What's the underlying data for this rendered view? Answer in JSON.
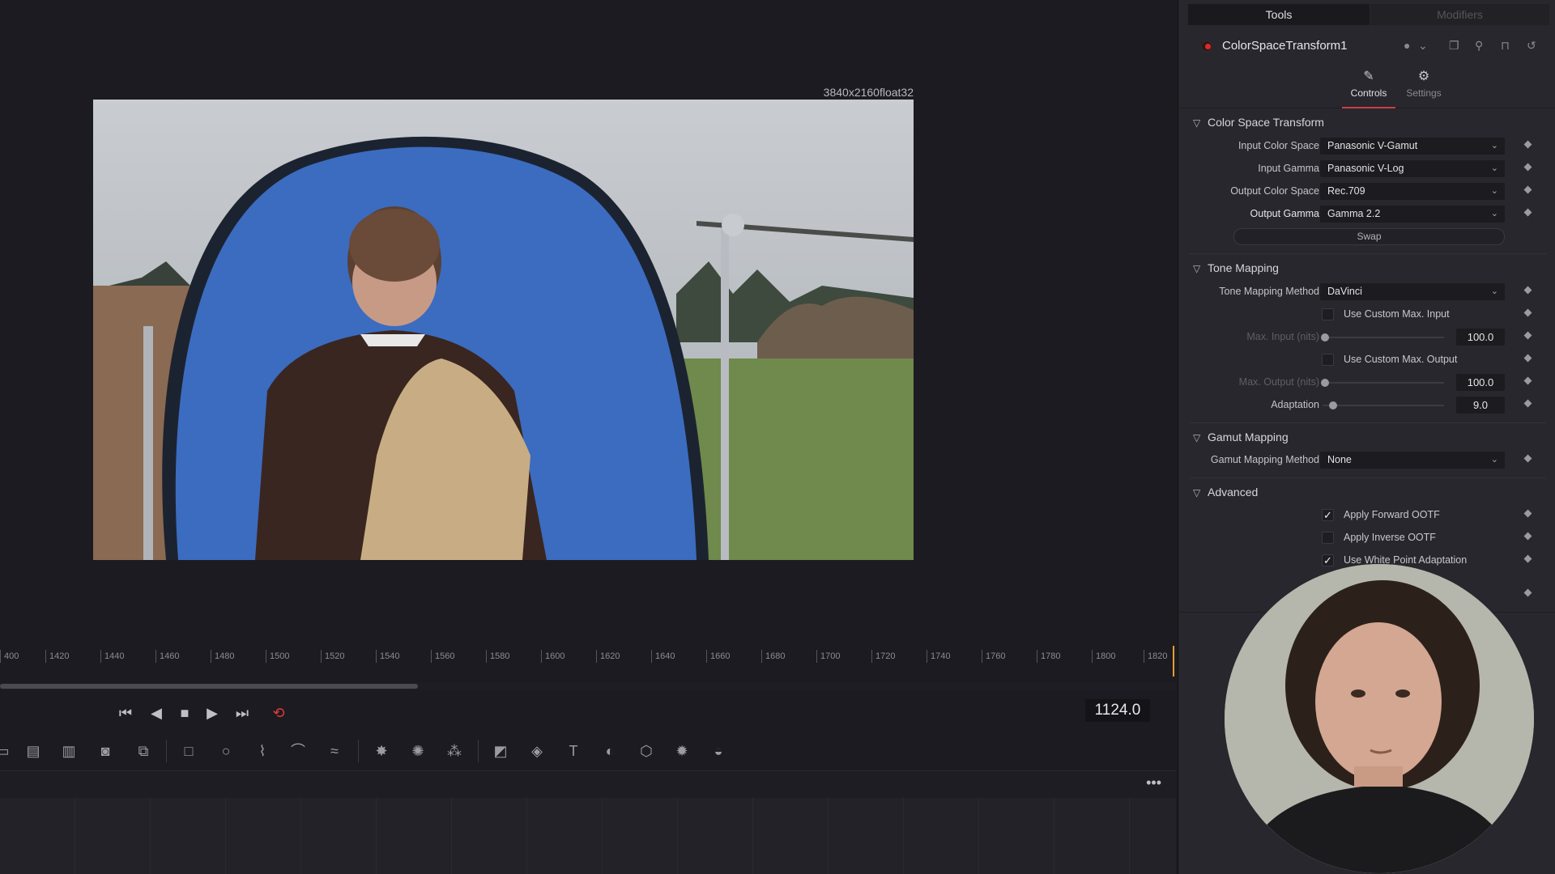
{
  "viewer": {
    "resolution": "3840x2160float32"
  },
  "ruler": {
    "ticks": [
      "400",
      "1420",
      "1440",
      "1460",
      "1480",
      "1500",
      "1520",
      "1540",
      "1560",
      "1580",
      "1600",
      "1620",
      "1640",
      "1660",
      "1680",
      "1700",
      "1720",
      "1740",
      "1760",
      "1780",
      "1800",
      "1820"
    ],
    "scroll_fraction": 0.355
  },
  "transport": {
    "timecode": "1124.0"
  },
  "panel": {
    "tabs": {
      "tools": "Tools",
      "modifiers": "Modifiers"
    },
    "node_name": "ColorSpaceTransform1",
    "subtabs": {
      "controls": "Controls",
      "settings": "Settings"
    },
    "sections": {
      "color_space_transform": "Color Space Transform",
      "tone_mapping": "Tone Mapping",
      "gamut_mapping": "Gamut Mapping",
      "advanced": "Advanced"
    },
    "cst": {
      "input_color_space_label": "Input Color Space",
      "input_color_space": "Panasonic V-Gamut",
      "input_gamma_label": "Input Gamma",
      "input_gamma": "Panasonic V-Log",
      "output_color_space_label": "Output Color Space",
      "output_color_space": "Rec.709",
      "output_gamma_label": "Output Gamma",
      "output_gamma": "Gamma 2.2",
      "swap_label": "Swap"
    },
    "tone": {
      "method_label": "Tone Mapping Method",
      "method": "DaVinci",
      "use_custom_max_input": "Use Custom Max. Input",
      "max_input_label": "Max. Input (nits)",
      "max_input": "100.0",
      "use_custom_max_output": "Use Custom Max. Output",
      "max_output_label": "Max. Output (nits)",
      "max_output": "100.0",
      "adaptation_label": "Adaptation",
      "adaptation": "9.0"
    },
    "gamut": {
      "method_label": "Gamut Mapping Method",
      "method": "None"
    },
    "advanced": {
      "apply_forward_ootf": "Apply Forward OOTF",
      "apply_forward_ootf_checked": true,
      "apply_inverse_ootf": "Apply Inverse OOTF",
      "apply_inverse_ootf_checked": false,
      "use_white_point_adaptation": "Use White Point Adaptation",
      "use_white_point_adaptation_checked": true
    }
  },
  "colors": {
    "accent_red": "#e02828",
    "playhead": "#e4a030",
    "loop_icon": "#e03a3a"
  }
}
